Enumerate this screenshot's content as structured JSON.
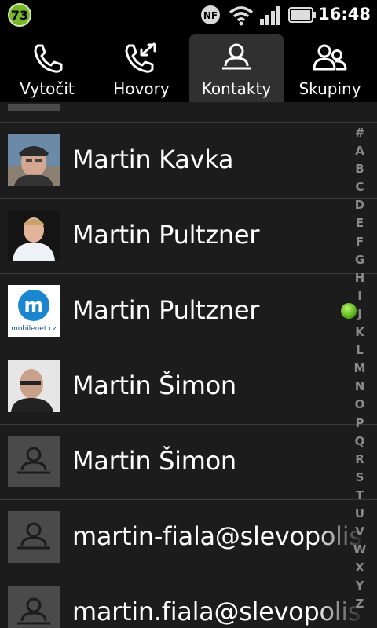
{
  "status_bar": {
    "notification_count": "73",
    "time": "16:48",
    "icons": [
      "nfc-icon",
      "wifi-icon",
      "signal-icon",
      "battery-icon"
    ]
  },
  "tabs": [
    {
      "label": "Vytočit",
      "icon": "phone-icon",
      "active": false
    },
    {
      "label": "Hovory",
      "icon": "call-log-icon",
      "active": false
    },
    {
      "label": "Kontakty",
      "icon": "person-icon",
      "active": true
    },
    {
      "label": "Skupiny",
      "icon": "group-icon",
      "active": false
    }
  ],
  "contacts": [
    {
      "name": "Martin Kavka",
      "avatar": "photo"
    },
    {
      "name": "Martin Pultzner",
      "avatar": "photo"
    },
    {
      "name": "Martin Pultzner",
      "avatar": "mobilenet-logo",
      "logo_text": "mobilenet.cz"
    },
    {
      "name": "Martin Šimon",
      "avatar": "photo"
    },
    {
      "name": "Martin Šimon",
      "avatar": "placeholder"
    },
    {
      "name": "martin-fiala@slevopolis.",
      "avatar": "placeholder"
    },
    {
      "name": "martin.fiala@slevopolis.",
      "avatar": "placeholder"
    }
  ],
  "alphabet_index": [
    "#",
    "A",
    "B",
    "C",
    "D",
    "E",
    "F",
    "G",
    "H",
    "I",
    "J",
    "K",
    "L",
    "M",
    "N",
    "O",
    "P",
    "Q",
    "R",
    "S",
    "T",
    "U",
    "V",
    "W",
    "X",
    "Y",
    "Z"
  ],
  "colors": {
    "accent_dot": "#5cb818",
    "badge": "#76b82a",
    "background": "#1c1c1c"
  }
}
